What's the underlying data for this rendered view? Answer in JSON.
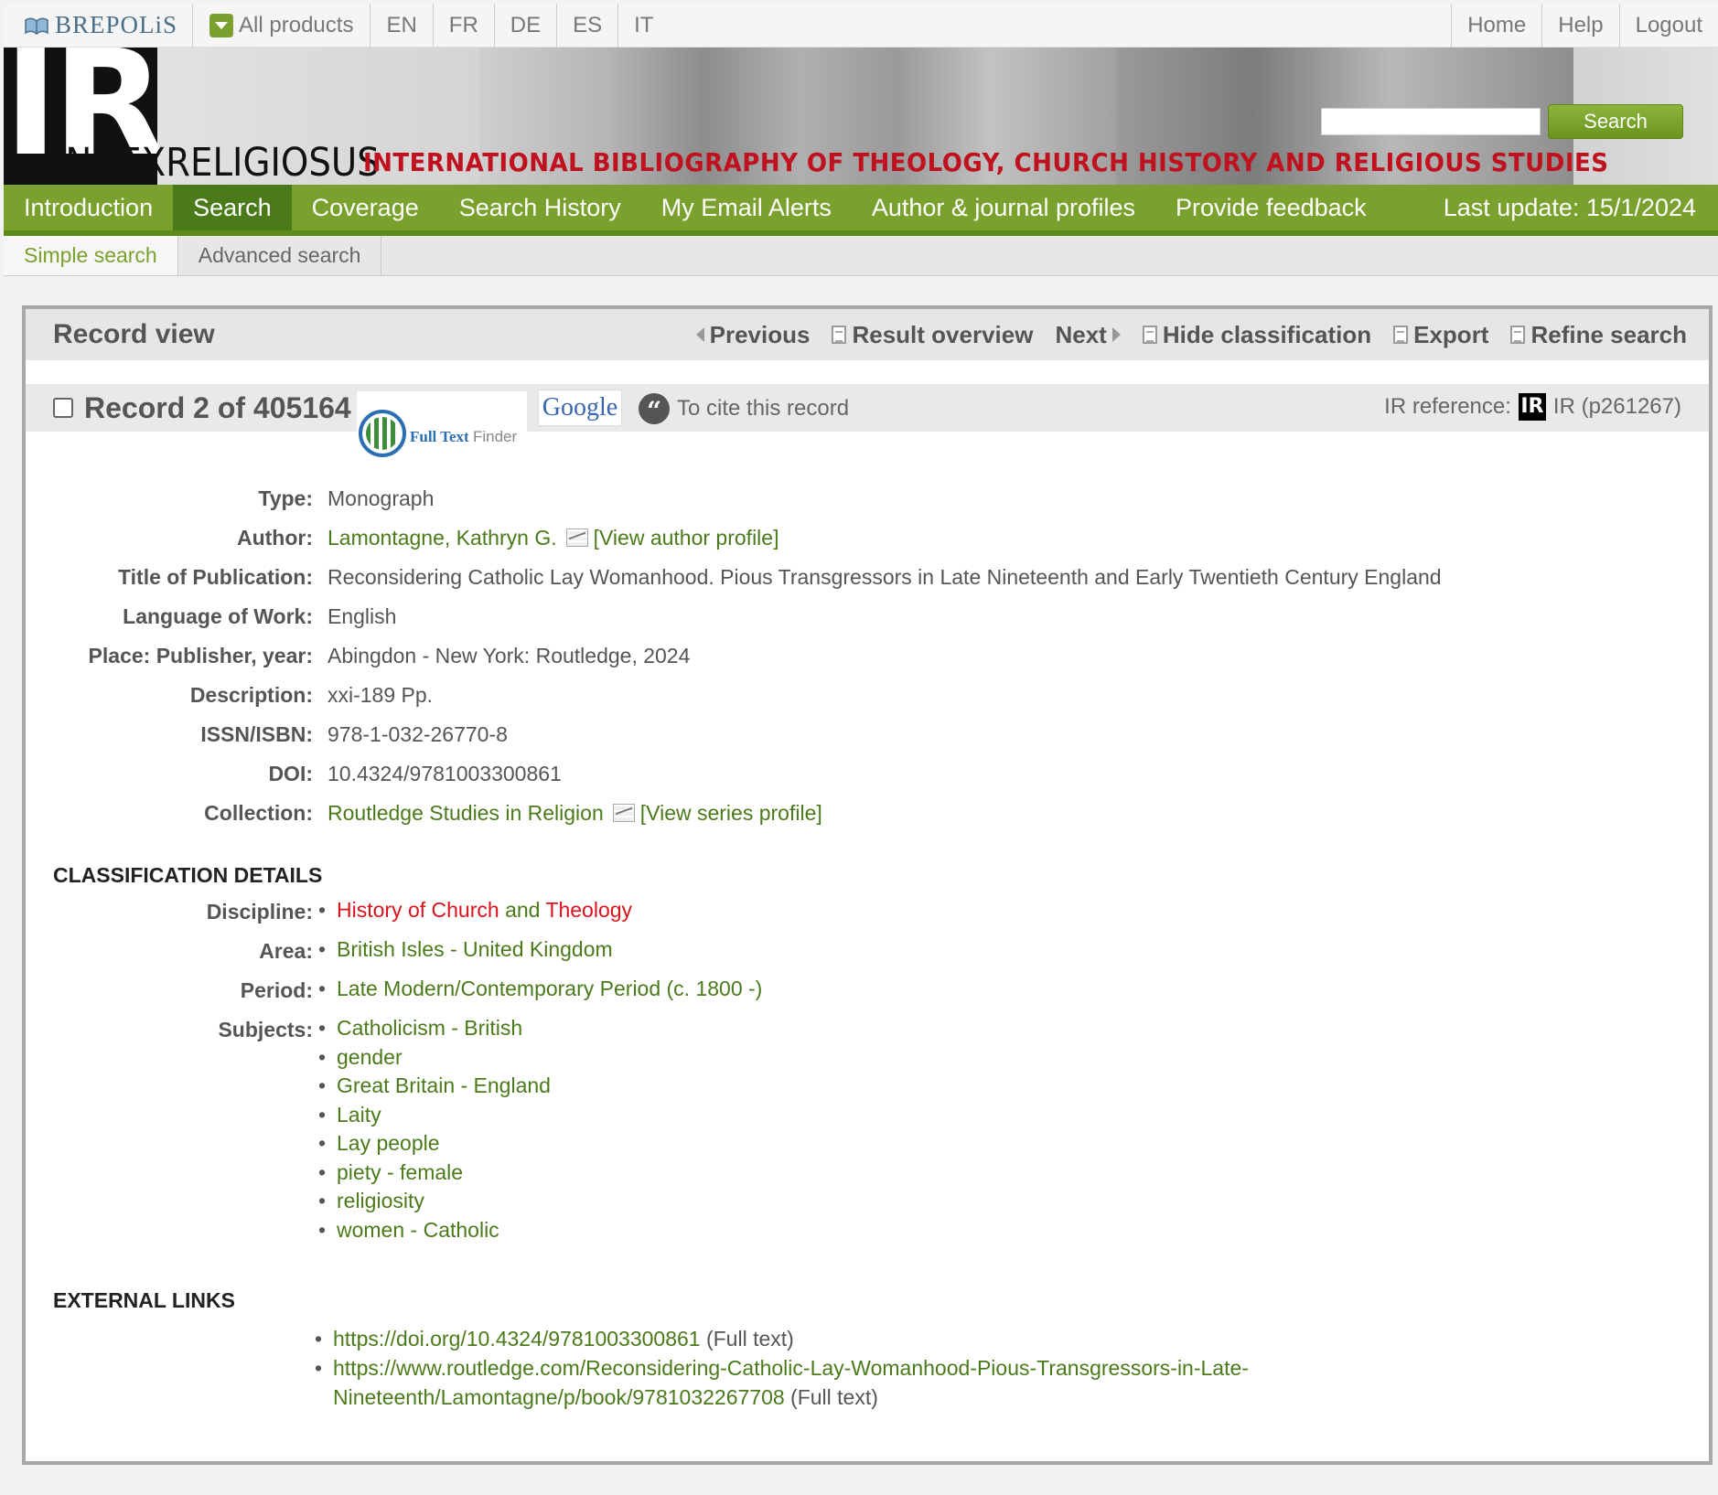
{
  "topbar": {
    "brand": "BREPOLiS",
    "all_products": "All products",
    "languages": [
      "EN",
      "FR",
      "DE",
      "ES",
      "IT"
    ],
    "right_links": [
      "Home",
      "Help",
      "Logout"
    ]
  },
  "banner": {
    "logo_letter": "IR",
    "wordmark_left": "INDEX",
    "wordmark_right": "RELIGIOSUS",
    "subtitle": "INTERNATIONAL BIBLIOGRAPHY OF THEOLOGY, CHURCH HISTORY AND RELIGIOUS STUDIES",
    "search_value": "",
    "search_button": "Search"
  },
  "mainnav": {
    "items": [
      "Introduction",
      "Search",
      "Coverage",
      "Search History",
      "My Email Alerts",
      "Author & journal profiles",
      "Provide feedback"
    ],
    "active": "Search",
    "last_update": "Last update: 15/1/2024"
  },
  "subnav": {
    "items": [
      "Simple search",
      "Advanced search"
    ],
    "active": "Simple search"
  },
  "record": {
    "panel_title": "Record view",
    "actions": {
      "previous": "Previous",
      "result_overview": "Result overview",
      "next": "Next",
      "hide_classification": "Hide classification",
      "export": "Export",
      "refine_search": "Refine search"
    },
    "record_label": "Record 2 of 405164",
    "full_text_finder": "Full Text",
    "full_text_finder_suffix": "Finder",
    "google": "Google",
    "cite": "To cite this record",
    "ir_reference_label": "IR reference:",
    "ir_reference_value": "IR (p261267)",
    "fields": {
      "type_label": "Type:",
      "type_value": "Monograph",
      "author_label": "Author:",
      "author_value": "Lamontagne, Kathryn G.",
      "author_profile": "[View author profile]",
      "title_label": "Title of Publication:",
      "title_value": "Reconsidering Catholic Lay Womanhood. Pious Transgressors in Late Nineteenth and Early Twentieth Century England",
      "language_label": "Language of Work:",
      "language_value": "English",
      "place_label": "Place: Publisher, year:",
      "place_value": "Abingdon - New York: Routledge, 2024",
      "description_label": "Description:",
      "description_value": "xxi-189 Pp.",
      "isbn_label": "ISSN/ISBN:",
      "isbn_value": "978-1-032-26770-8",
      "doi_label": "DOI:",
      "doi_value": "10.4324/9781003300861",
      "collection_label": "Collection:",
      "collection_value": "Routledge Studies in Religion",
      "series_profile": "[View series profile]"
    },
    "classification": {
      "heading": "CLASSIFICATION DETAILS",
      "discipline_label": "Discipline:",
      "discipline_part1": "History of Church",
      "discipline_and": "and",
      "discipline_part2": "Theology",
      "area_label": "Area:",
      "area_items": [
        "British Isles - United Kingdom"
      ],
      "period_label": "Period:",
      "period_items": [
        "Late Modern/Contemporary Period (c. 1800 -)"
      ],
      "subjects_label": "Subjects:",
      "subjects": [
        "Catholicism - British",
        "gender",
        "Great Britain - England",
        "Laity",
        "Lay people",
        "piety - female",
        "religiosity",
        "women - Catholic"
      ]
    },
    "external": {
      "heading": "EXTERNAL LINKS",
      "links": [
        {
          "url": "https://doi.org/10.4324/9781003300861",
          "note": " (Full text)"
        },
        {
          "url_line1": "https://www.routledge.com/Reconsidering-Catholic-Lay-Womanhood-Pious-Transgressors-in-Late-",
          "url_line2": "Nineteenth/Lamontagne/p/book/9781032267708",
          "note": " (Full text)"
        }
      ]
    }
  }
}
